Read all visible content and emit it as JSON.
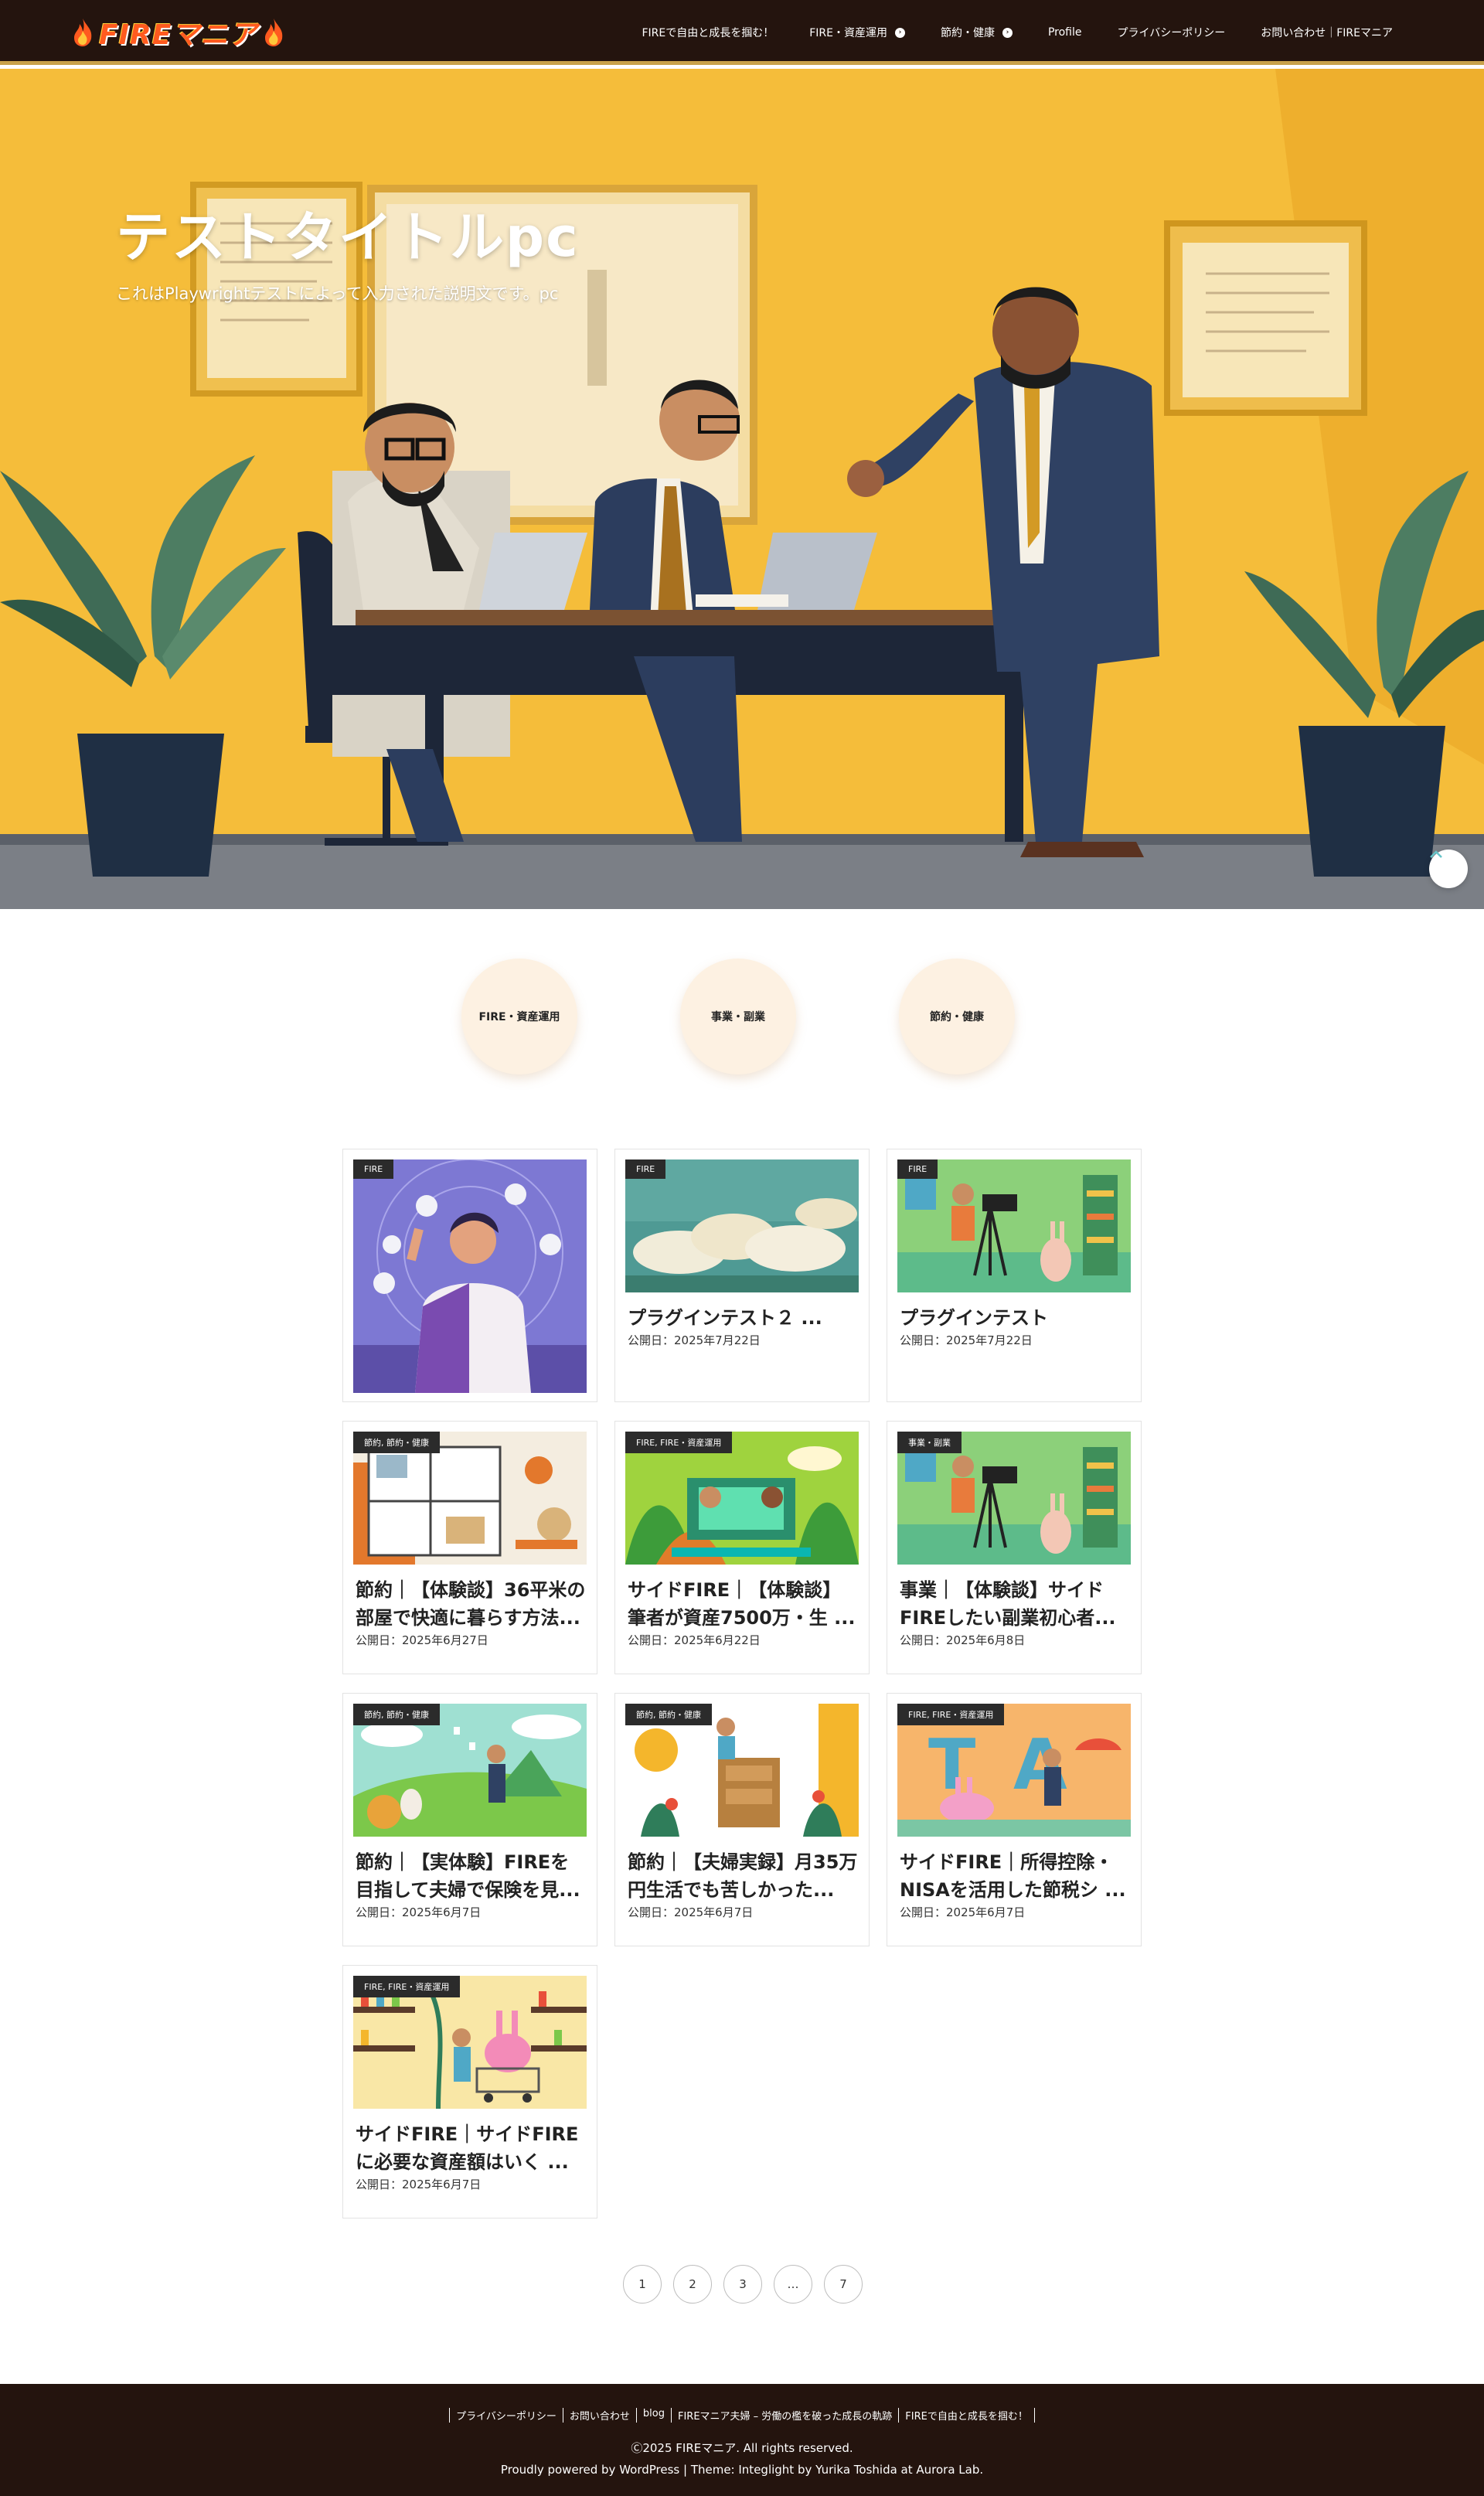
{
  "header": {
    "logo_text": "FIREマニア",
    "nav": [
      {
        "label": "FIREで自由と成長を掴む！"
      },
      {
        "label": "FIRE・資産運用"
      },
      {
        "label": "節約・健康"
      },
      {
        "label": "Profile"
      },
      {
        "label": "プライバシーポリシー"
      },
      {
        "label": "お問い合わせ｜FIREマニア"
      }
    ]
  },
  "hero": {
    "title": "テストタイトルpc",
    "description": "これはPlaywrightテストによって入力された説明文です。pc"
  },
  "categories": [
    {
      "label": "FIRE・資産運用"
    },
    {
      "label": "事業・副業"
    },
    {
      "label": "節約・健康"
    }
  ],
  "posts": [
    {
      "tag": "FIRE",
      "title": "",
      "date": ""
    },
    {
      "tag": "FIRE",
      "title": "プラグインテスト２ ...",
      "date": "公開日：2025年7月22日"
    },
    {
      "tag": "FIRE",
      "title": "プラグインテスト",
      "date": "公開日：2025年7月22日"
    },
    {
      "tag": "節約, 節約・健康",
      "title": "節約｜【体験談】36平米の部屋で快適に暮らす方法...",
      "date": "公開日：2025年6月27日"
    },
    {
      "tag": "FIRE, FIRE・資産運用",
      "title": "サイドFIRE｜【体験談】筆者が資産7500万・生 ...",
      "date": "公開日：2025年6月22日"
    },
    {
      "tag": "事業・副業",
      "title": "事業｜【体験談】サイドFIREしたい副業初心者...",
      "date": "公開日：2025年6月8日"
    },
    {
      "tag": "節約, 節約・健康",
      "title": "節約｜【実体験】FIREを目指して夫婦で保険を見...",
      "date": "公開日：2025年6月7日"
    },
    {
      "tag": "節約, 節約・健康",
      "title": "節約｜【夫婦実録】月35万円生活でも苦しかった...",
      "date": "公開日：2025年6月7日"
    },
    {
      "tag": "FIRE, FIRE・資産運用",
      "title": "サイドFIRE｜所得控除・NISAを活用した節税シ ...",
      "date": "公開日：2025年6月7日"
    },
    {
      "tag": "FIRE, FIRE・資産運用",
      "title": "サイドFIRE｜サイドFIREに必要な資産額はいく ...",
      "date": "公開日：2025年6月7日"
    }
  ],
  "pagination": [
    "1",
    "2",
    "3",
    "…",
    "7"
  ],
  "footer": {
    "links": [
      "プライバシーポリシー",
      "お問い合わせ",
      "blog",
      "FIREマニア夫婦 – 労働の檻を破った成長の軌跡",
      "FIREで自由と成長を掴む！"
    ],
    "copyright": "Ⓒ2025 FIREマニア. All rights reserved.",
    "powered": "Proudly powered by WordPress | Theme: Integlight by Yurika Toshida at Aurora Lab."
  },
  "colors": {
    "header_bg": "#24140e",
    "accent": "#c9a24a",
    "hero_bg": "#f3b52f",
    "category_bg": "#fdf1e2"
  }
}
